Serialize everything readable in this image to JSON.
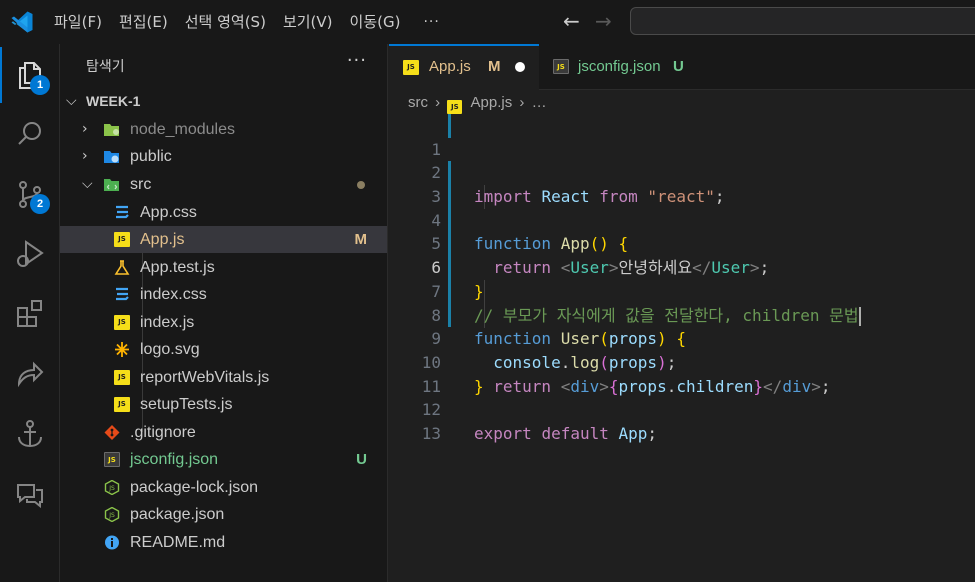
{
  "menu": [
    "파일(F)",
    "편집(E)",
    "선택 영역(S)",
    "보기(V)",
    "이동(G)",
    "···"
  ],
  "activity": {
    "explorer_badge": "1",
    "scm_badge": "2"
  },
  "sidebar": {
    "title": "탐색기",
    "more": "···",
    "root": "WEEK-1",
    "items": [
      {
        "name": "node_modules",
        "status": ""
      },
      {
        "name": "public",
        "status": ""
      },
      {
        "name": "src",
        "status": ""
      },
      {
        "name": "App.css",
        "status": ""
      },
      {
        "name": "App.js",
        "status": "M"
      },
      {
        "name": "App.test.js",
        "status": ""
      },
      {
        "name": "index.css",
        "status": ""
      },
      {
        "name": "index.js",
        "status": ""
      },
      {
        "name": "logo.svg",
        "status": ""
      },
      {
        "name": "reportWebVitals.js",
        "status": ""
      },
      {
        "name": "setupTests.js",
        "status": ""
      },
      {
        "name": ".gitignore",
        "status": ""
      },
      {
        "name": "jsconfig.json",
        "status": "U"
      },
      {
        "name": "package-lock.json",
        "status": ""
      },
      {
        "name": "package.json",
        "status": ""
      },
      {
        "name": "README.md",
        "status": ""
      }
    ]
  },
  "tabs": [
    {
      "label": "App.js",
      "status": "M",
      "icon": "JS"
    },
    {
      "label": "jsconfig.json",
      "status": "U",
      "icon": "JS"
    }
  ],
  "breadcrumb": {
    "folder": "src",
    "file": "App.js",
    "more": "…"
  },
  "editor": {
    "line_numbers": [
      "1",
      "2",
      "3",
      "4",
      "5",
      "6",
      "7",
      "8",
      "9",
      "10",
      "11",
      "12",
      "13"
    ],
    "comment": "// 부모가 자식에게 값을 전달한다, children 문법",
    "greeting": "안녕하세요",
    "colors": {
      "accent": "#0078d4",
      "modified": "#e2c08d",
      "untracked": "#73c991"
    }
  }
}
